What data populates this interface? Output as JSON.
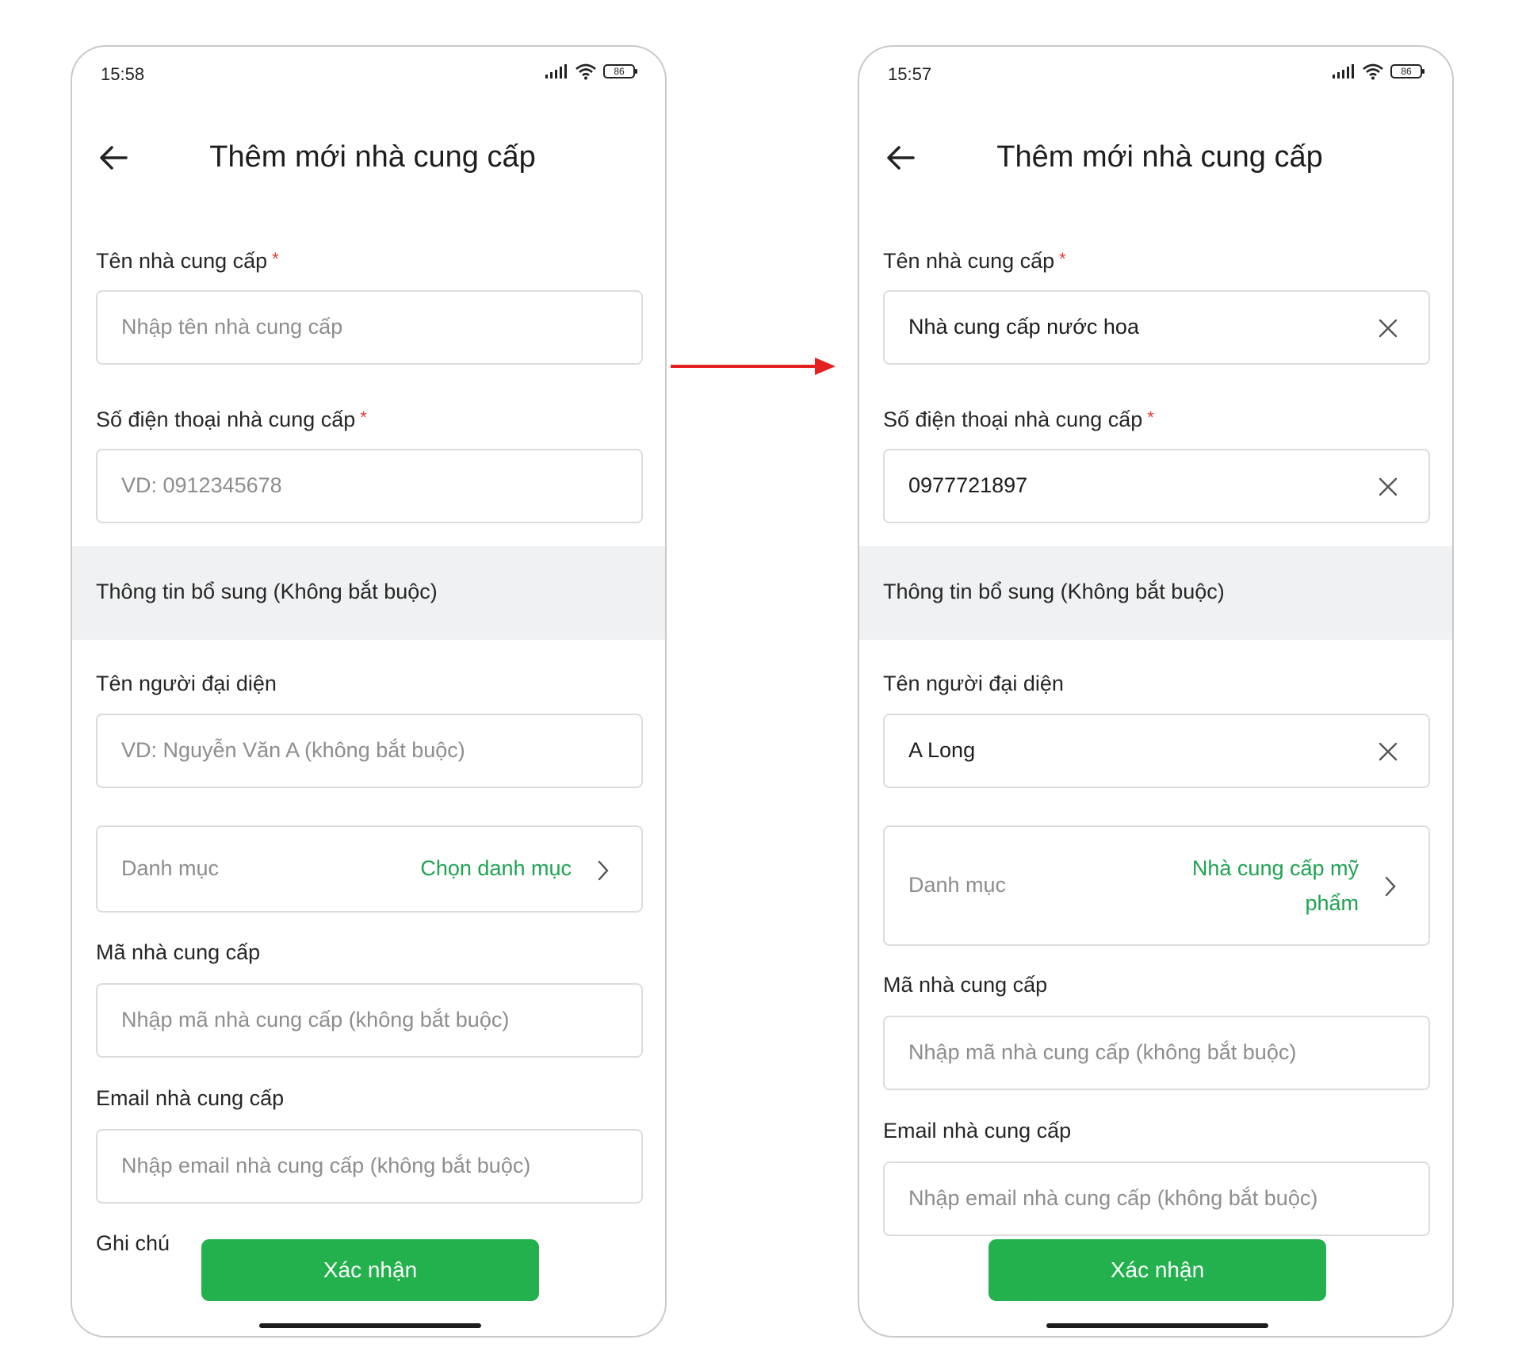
{
  "left_screen": {
    "time": "15:58",
    "battery": "86",
    "title": "Thêm mới nhà cung cấp",
    "supplier_name_label": "Tên nhà cung cấp",
    "supplier_name_placeholder": "Nhập tên nhà cung cấp",
    "phone_label": "Số điện thoại nhà cung cấp",
    "phone_placeholder": "VD: 0912345678",
    "section_title": "Thông tin bổ sung (Không bắt buộc)",
    "rep_label": "Tên người đại diện",
    "rep_placeholder": "VD: Nguyễn Văn A (không bắt buộc)",
    "category_label": "Danh mục",
    "category_value": "Chọn danh mục",
    "code_label": "Mã nhà cung cấp",
    "code_placeholder": "Nhập mã nhà cung cấp (không bắt buộc)",
    "email_label": "Email nhà cung cấp",
    "email_placeholder": "Nhập email nhà cung cấp (không bắt buộc)",
    "note_label": "Ghi chú",
    "confirm": "Xác nhận"
  },
  "right_screen": {
    "time": "15:57",
    "battery": "86",
    "title": "Thêm mới nhà cung cấp",
    "supplier_name_label": "Tên nhà cung cấp",
    "supplier_name_value": "Nhà cung cấp nước hoa",
    "phone_label": "Số điện thoại nhà cung cấp",
    "phone_value": "0977721897",
    "section_title": "Thông tin bổ sung (Không bắt buộc)",
    "rep_label": "Tên người đại diện",
    "rep_value": "A Long",
    "category_label": "Danh mục",
    "category_value_line1": "Nhà cung cấp mỹ",
    "category_value_line2": "phẩm",
    "code_label": "Mã nhà cung cấp",
    "code_placeholder": "Nhập mã nhà cung cấp (không bắt buộc)",
    "email_label": "Email nhà cung cấp",
    "email_placeholder": "Nhập email nhà cung cấp (không bắt buộc)",
    "confirm": "Xác nhận"
  },
  "required_marker": "*",
  "colors": {
    "accent": "#22b14c",
    "accent_text": "#1ea352",
    "required": "#e53935",
    "arrow": "#e52020",
    "section_bg": "#f0f1f3"
  },
  "icons": [
    "back-arrow-icon",
    "signal-icon",
    "wifi-icon",
    "battery-icon",
    "clear-icon",
    "chevron-right-icon",
    "transition-arrow-icon"
  ]
}
